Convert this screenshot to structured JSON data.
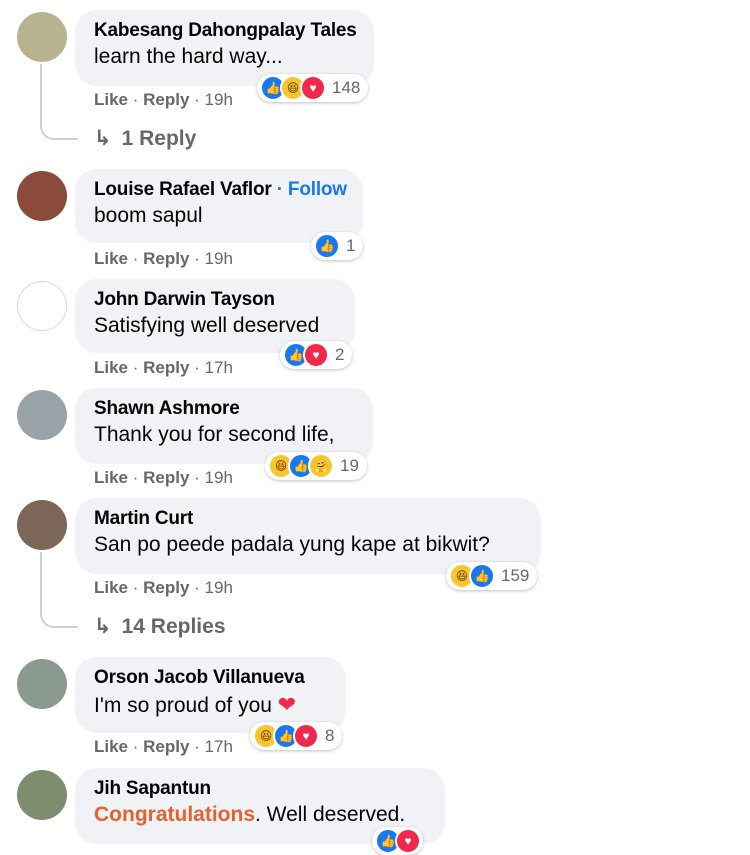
{
  "comments": [
    {
      "name": "Kabesang Dahongpalay Tales",
      "follow": "",
      "text": "learn the hard way...",
      "like": "Like",
      "reply": "Reply",
      "time": "19h",
      "reactions": [
        "like",
        "haha",
        "love"
      ],
      "count": "148",
      "replies": "1 Reply"
    },
    {
      "name": "Louise Rafael Vaflor",
      "follow": "Follow",
      "text": "boom sapul",
      "like": "Like",
      "reply": "Reply",
      "time": "19h",
      "reactions": [
        "like"
      ],
      "count": "1"
    },
    {
      "name": "John Darwin Tayson",
      "follow": "",
      "text": "Satisfying well deserved",
      "like": "Like",
      "reply": "Reply",
      "time": "17h",
      "reactions": [
        "like",
        "love"
      ],
      "count": "2"
    },
    {
      "name": "Shawn Ashmore",
      "follow": "",
      "text": "Thank you for second life,",
      "like": "Like",
      "reply": "Reply",
      "time": "19h",
      "reactions": [
        "haha",
        "like",
        "care"
      ],
      "count": "19"
    },
    {
      "name": "Martin Curt",
      "follow": "",
      "text": "San po peede padala yung kape at bikwit?",
      "like": "Like",
      "reply": "Reply",
      "time": "19h",
      "reactions": [
        "haha",
        "like"
      ],
      "count": "159",
      "replies": "14 Replies"
    },
    {
      "name": "Orson Jacob Villanueva",
      "follow": "",
      "text": "I'm so proud of you",
      "emoji": "❤",
      "like": "Like",
      "reply": "Reply",
      "time": "17h",
      "reactions": [
        "haha",
        "like",
        "love"
      ],
      "count": "8"
    },
    {
      "name": "Jih Sapantun",
      "follow": "",
      "text_highlight": "Congratulations",
      "text": ". Well deserved.",
      "reactions": [
        "like",
        "love"
      ]
    }
  ],
  "separator": " · ",
  "icons": {
    "reply-arrow": "↳",
    "like": "👍",
    "haha": "😆",
    "love": "♥",
    "care": "🤗"
  },
  "colors": {
    "like": "#1877f2",
    "love": "#f02849",
    "haha": "#f7c52e",
    "follow": "#1877f2",
    "highlight": "#e8602c"
  }
}
